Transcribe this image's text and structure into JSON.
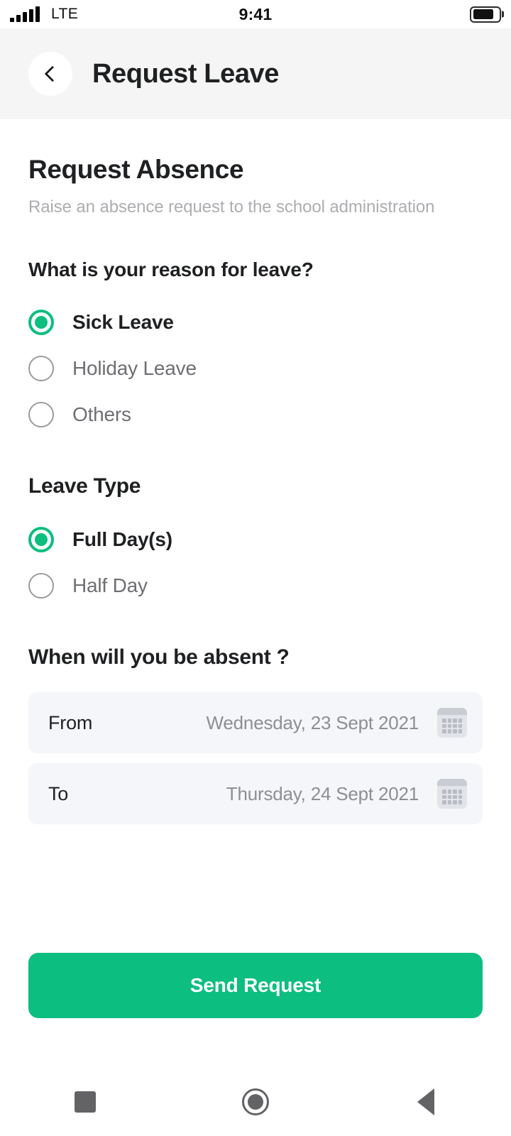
{
  "status_bar": {
    "network": "LTE",
    "time": "9:41",
    "signal_icon": "signal-bars-icon",
    "battery_icon": "battery-icon",
    "battery_level_percent": 82
  },
  "app_bar": {
    "back_icon": "chevron-left-icon",
    "title": "Request Leave"
  },
  "page": {
    "title": "Request Absence",
    "subtitle": "Raise an absence request to the school administration"
  },
  "reason_section": {
    "question": "What is your reason for leave?",
    "options": [
      {
        "label": "Sick Leave",
        "selected": true
      },
      {
        "label": "Holiday Leave",
        "selected": false
      },
      {
        "label": "Others",
        "selected": false
      }
    ]
  },
  "leave_type_section": {
    "heading": "Leave Type",
    "options": [
      {
        "label": "Full Day(s)",
        "selected": true
      },
      {
        "label": "Half Day",
        "selected": false
      }
    ]
  },
  "dates_section": {
    "heading": "When will you be absent ?",
    "rows": [
      {
        "label": "From",
        "value": "Wednesday, 23 Sept 2021",
        "icon": "calendar-icon"
      },
      {
        "label": "To",
        "value": "Thursday, 24 Sept 2021",
        "icon": "calendar-icon"
      }
    ]
  },
  "submit": {
    "label": "Send Request"
  },
  "nav_bar": {
    "recents_icon": "square-recents-icon",
    "home_icon": "circle-home-icon",
    "back_icon": "triangle-back-icon"
  },
  "colors": {
    "accent_green": "#0CBE80",
    "app_bar_bg": "#F5F5F5",
    "field_bg": "#F4F6F9",
    "text_primary": "#1F2022",
    "text_muted": "#8E8E93",
    "text_subtitle": "#AEAEB2"
  }
}
